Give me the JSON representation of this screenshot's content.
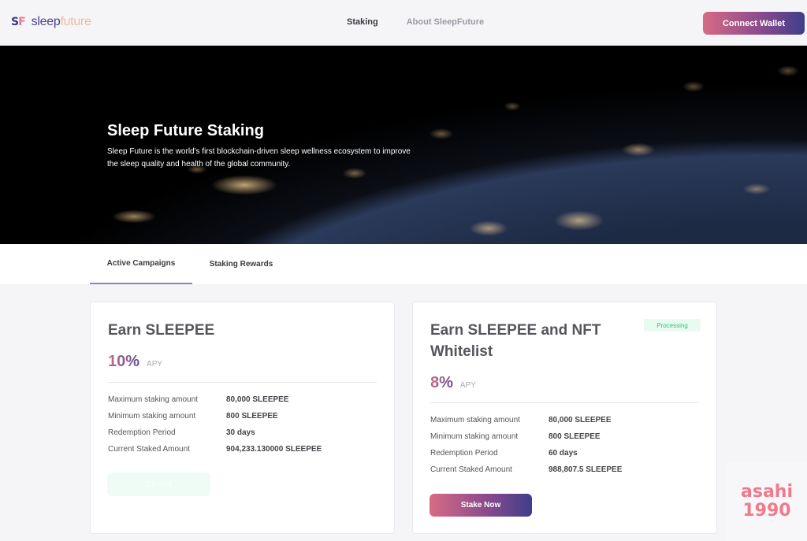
{
  "header": {
    "logo_mark": {
      "s": "S",
      "f": "F"
    },
    "logo_text": {
      "part1": "sleep",
      "part2": "future"
    },
    "nav": [
      {
        "label": "Staking",
        "active": true
      },
      {
        "label": "About SleepFuture",
        "active": false
      }
    ],
    "connect_wallet_label": "Connect Wallet"
  },
  "hero": {
    "title": "Sleep Future Staking",
    "description": "Sleep Future is the world's first blockchain-driven sleep wellness ecosystem to improve the sleep quality and health of the global community."
  },
  "tabs": [
    {
      "label": "Active Campaigns",
      "active": true
    },
    {
      "label": "Staking Rewards",
      "active": false
    }
  ],
  "campaigns": [
    {
      "title": "Earn SLEEPEE",
      "apy": "10%",
      "apy_label": "APY",
      "status": null,
      "details": [
        {
          "label": "Maximum staking amount",
          "value": "80,000 SLEEPEE"
        },
        {
          "label": "Minimum staking amount",
          "value": "800 SLEEPEE"
        },
        {
          "label": "Redemption Period",
          "value": "30 days"
        },
        {
          "label": "Current Staked Amount",
          "value": "904,233.130000 SLEEPEE"
        }
      ],
      "action_label": "Closed",
      "action_enabled": false
    },
    {
      "title": "Earn SLEEPEE and NFT Whitelist",
      "apy": "8%",
      "apy_label": "APY",
      "status": "Processing",
      "details": [
        {
          "label": "Maximum staking amount",
          "value": "80,000 SLEEPEE"
        },
        {
          "label": "Minimum staking amount",
          "value": "800 SLEEPEE"
        },
        {
          "label": "Redemption Period",
          "value": "60 days"
        },
        {
          "label": "Current Staked Amount",
          "value": "988,807.5 SLEEPEE"
        }
      ],
      "action_label": "Stake Now",
      "action_enabled": true
    }
  ],
  "watermark": {
    "line1": "asahi",
    "line2": "1990"
  },
  "colors": {
    "accent_gradient_start": "#d76b84",
    "accent_gradient_end": "#3f3e8a",
    "status_green": "#3cc07c",
    "tab_underline": "#8c80c8"
  }
}
